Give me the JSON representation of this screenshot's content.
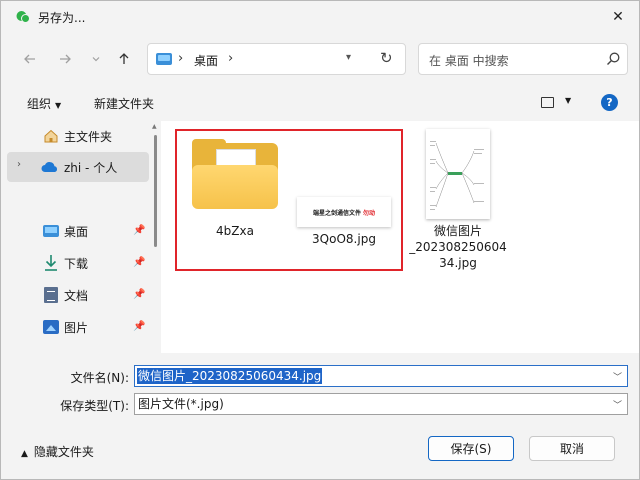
{
  "window": {
    "title": "另存为..."
  },
  "nav": {
    "back_icon": "arrow-left-icon",
    "forward_icon": "arrow-right-icon",
    "recent_icon": "chevron-down-icon",
    "up_icon": "arrow-up-icon",
    "address": "桌面",
    "search_placeholder": "在 桌面 中搜索"
  },
  "toolbar": {
    "organize_label": "组织",
    "new_folder_label": "新建文件夹"
  },
  "sidebar": {
    "items": [
      {
        "label": "主文件夹",
        "icon": "home-icon"
      },
      {
        "label": "zhi - 个人",
        "icon": "onedrive-cloud-icon"
      },
      {
        "label": "桌面",
        "icon": "desktop-icon"
      },
      {
        "label": "下载",
        "icon": "download-icon"
      },
      {
        "label": "文档",
        "icon": "document-icon"
      },
      {
        "label": "图片",
        "icon": "picture-icon"
      }
    ]
  },
  "files": [
    {
      "name": "4bZxa",
      "type": "folder"
    },
    {
      "name": "3QoO8.jpg",
      "type": "image",
      "thumb_text": "端星之剑通信文件",
      "thumb_red_text": "勿动"
    },
    {
      "name": "微信图片_20230825060434.jpg",
      "type": "image",
      "lines": [
        "微信图片",
        "_202308250604",
        "34.jpg"
      ]
    }
  ],
  "form": {
    "filename_label": "文件名(N):",
    "filename_value": "微信图片_20230825060434.jpg",
    "filetype_label": "保存类型(T):",
    "filetype_value": "图片文件(*.jpg)"
  },
  "footer": {
    "hide_folders_label": "隐藏文件夹",
    "save_label": "保存(S)",
    "cancel_label": "取消"
  },
  "colors": {
    "accent": "#1467c4",
    "highlight_border": "#e0242a",
    "folder": "#f6c24a"
  }
}
